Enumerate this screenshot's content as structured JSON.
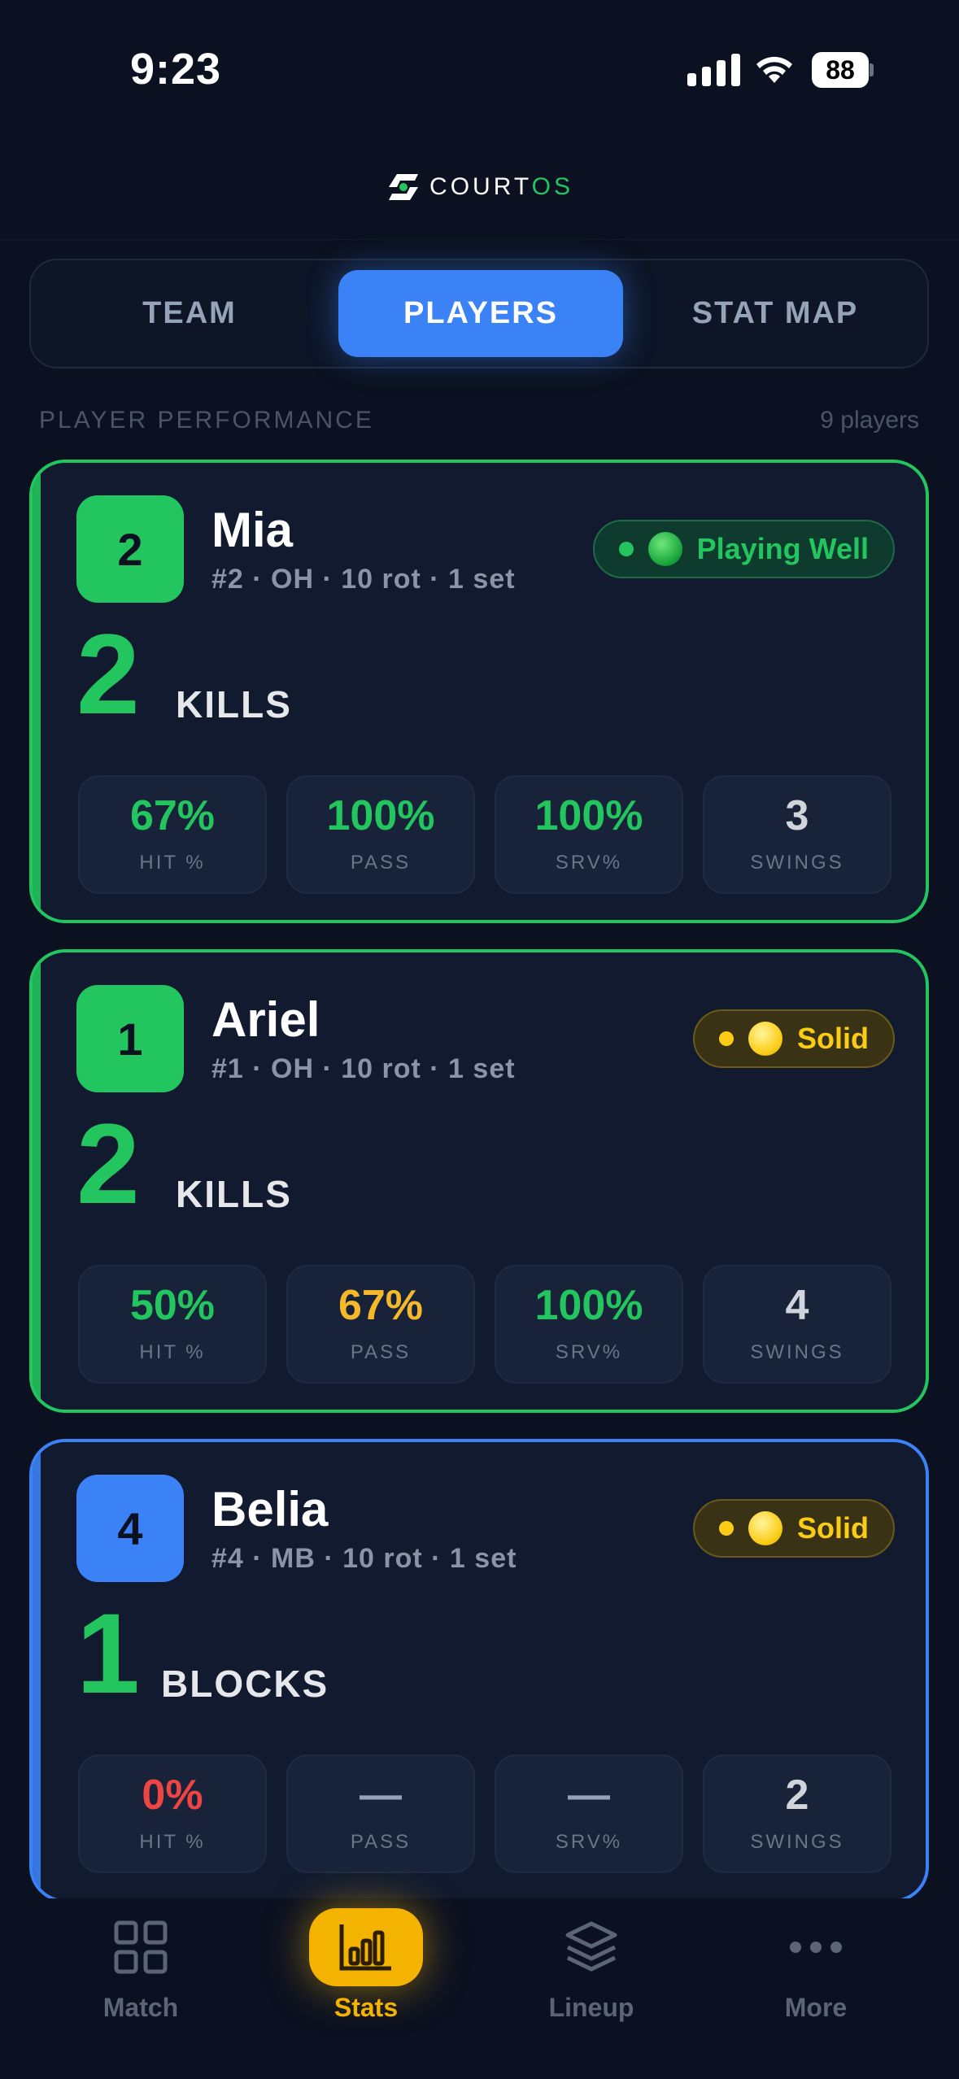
{
  "status_bar": {
    "time": "9:23",
    "battery": "88"
  },
  "header": {
    "logo_word": "COURT",
    "logo_suffix": "OS"
  },
  "segments": [
    {
      "label": "TEAM",
      "active": false
    },
    {
      "label": "PLAYERS",
      "active": true
    },
    {
      "label": "STAT MAP",
      "active": false
    }
  ],
  "section": {
    "title": "PLAYER PERFORMANCE",
    "count": "9 players"
  },
  "players": [
    {
      "number": "2",
      "name": "Mia",
      "meta": "#2 · OH  ·  10 rot · 1 set",
      "status": "Playing Well",
      "status_color": "#22c55e",
      "big_value": "2",
      "big_label": "KILLS",
      "stats": [
        {
          "value": "67%",
          "label": "HIT %",
          "color": "#22c55e"
        },
        {
          "value": "100%",
          "label": "PASS",
          "color": "#22c55e"
        },
        {
          "value": "100%",
          "label": "SRV%",
          "color": "#22c55e"
        },
        {
          "value": "3",
          "label": "SWINGS",
          "color": "#d1d5db"
        }
      ]
    },
    {
      "number": "1",
      "name": "Ariel",
      "meta": "#1 · OH  ·  10 rot · 1 set",
      "status": "Solid",
      "status_color": "#facc15",
      "big_value": "2",
      "big_label": "KILLS",
      "stats": [
        {
          "value": "50%",
          "label": "HIT %",
          "color": "#22c55e"
        },
        {
          "value": "67%",
          "label": "PASS",
          "color": "#f5b82a"
        },
        {
          "value": "100%",
          "label": "SRV%",
          "color": "#22c55e"
        },
        {
          "value": "4",
          "label": "SWINGS",
          "color": "#d1d5db"
        }
      ]
    },
    {
      "number": "4",
      "name": "Belia",
      "meta": "#4 · MB  ·  10 rot · 1 set",
      "status": "Solid",
      "status_color": "#facc15",
      "big_value": "1",
      "big_label": "BLOCKS",
      "stats": [
        {
          "value": "0%",
          "label": "HIT %",
          "color": "#ef4444"
        },
        {
          "value": "—",
          "label": "PASS",
          "color": "#94a3b8"
        },
        {
          "value": "—",
          "label": "SRV%",
          "color": "#94a3b8"
        },
        {
          "value": "2",
          "label": "SWINGS",
          "color": "#d1d5db"
        }
      ]
    }
  ],
  "tabs": [
    {
      "label": "Match",
      "icon": "grid-icon",
      "active": false
    },
    {
      "label": "Stats",
      "icon": "bar-chart-icon",
      "active": true
    },
    {
      "label": "Lineup",
      "icon": "layers-icon",
      "active": false
    },
    {
      "label": "More",
      "icon": "more-dots-icon",
      "active": false
    }
  ],
  "colors": {
    "accent_blue": "#3b82f6",
    "accent_green": "#22c55e",
    "accent_yellow": "#f5b301",
    "background": "#0b1120"
  }
}
